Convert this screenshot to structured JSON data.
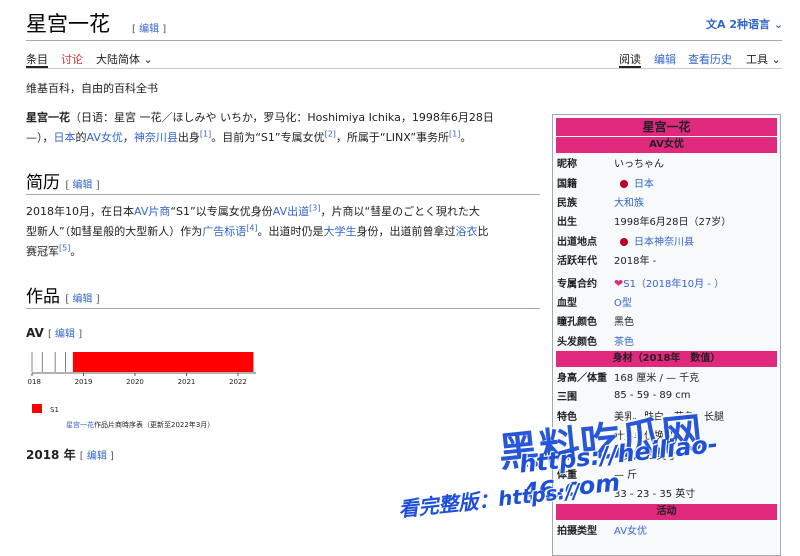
{
  "header": {
    "title": "星宫一花",
    "edit_label": "编辑",
    "languages_label": "2种语言"
  },
  "tabs": {
    "article": "条目",
    "talk": "讨论",
    "variant": "大陆简体",
    "read": "阅读",
    "edit": "编辑",
    "history": "查看历史",
    "tools": "工具"
  },
  "tagline": "维基百科，自由的百科全书",
  "intro": {
    "name": "星宫一花",
    "p1": "（日语：星宮 一花／ほしみや いちか，罗马化：Hoshimiya Ichika，1998年6月28日",
    "p2a": "—），",
    "japan": "日本",
    "p2b": "的",
    "av_actress": "AV女优",
    "p2c": "，",
    "kanagawa": "神奈川县",
    "p2d": "出身",
    "ref1": "[1]",
    "p2e": "。目前为“S1”专属女优",
    "ref2": "[2]",
    "p2f": "，所属于“LINX”事务所",
    "ref3": "[1]",
    "p2g": "。"
  },
  "sections": {
    "biography": {
      "title": "简历",
      "edit": "编辑",
      "t1": "2018年10月，在日本",
      "l1": "AV片商",
      "t2": "“S1”以专属女优身份",
      "l2": "AV出道",
      "r1": "[3]",
      "t3": "，片商以“彗星のごとく現れた大",
      "t4": "型新人”（如彗星般的大型新人）作为",
      "l3": "广告标语",
      "r2": "[4]",
      "t5": "。出道时仍是",
      "l4": "大学生",
      "t6": "身份，出道前曾拿过",
      "l5": "浴衣",
      "t7": "比",
      "t8": "赛冠军",
      "r3": "[5]",
      "t9": "。"
    },
    "works": {
      "title": "作品",
      "edit": "编辑"
    },
    "av": {
      "title": "AV",
      "edit": "编辑"
    },
    "y2018": {
      "title": "2018 年",
      "edit": "编辑"
    }
  },
  "timeline": {
    "years": [
      "2018",
      "2019",
      "2020",
      "2021",
      "2022"
    ],
    "legend_label": "S1",
    "caption_link": "星宫一花",
    "caption_text": "作品片商時序表（更新至2022年3月）",
    "bar_color": "#ff0000",
    "bar_start_year": 2018.8,
    "bar_end_year": 2022.3,
    "tick_years": [
      2018.0,
      2018.2,
      2018.45,
      2018.65,
      2018.8
    ]
  },
  "infobox": {
    "title": "星宫一花",
    "subtitle": "AV女优",
    "rows1": [
      {
        "key": "昵称",
        "value": "いっちゃん",
        "link": false,
        "flag": false
      },
      {
        "key": "国籍",
        "value": "日本",
        "link": true,
        "flag": true
      },
      {
        "key": "民族",
        "value": "大和族",
        "link": true,
        "flag": false
      },
      {
        "key": "出生",
        "value": "1998年6月28日（27岁）",
        "link": false,
        "flag": false
      },
      {
        "key": "出道地点",
        "value": "日本神奈川县",
        "link": true,
        "flag": true
      },
      {
        "key": "活跃年代",
        "value": "2018年 -",
        "link": false,
        "flag": false
      }
    ],
    "rows2": [
      {
        "key": "专属合约",
        "value": "S1（2018年10月 - ）",
        "heart": true
      },
      {
        "key": "血型",
        "value": "O型",
        "link": true
      },
      {
        "key": "瞳孔颜色",
        "value": "黑色",
        "link": false
      },
      {
        "key": "头发颜色",
        "value": "茶色",
        "link": true
      }
    ],
    "body_header": "身材（2018年　数值）",
    "rows3": [
      {
        "key": "身高／体重",
        "value": "168 厘米 / — 千克"
      },
      {
        "key": "三围",
        "value": "85 - 59 - 89 cm"
      },
      {
        "key": "特色",
        "value": "美乳、肤白、苗条、长腿"
      },
      {
        "key": "",
        "value": "计量单位换算"
      },
      {
        "key": "身高",
        "value": "5 英尺 6 英寸"
      },
      {
        "key": "体重",
        "value": "— 斤"
      },
      {
        "key": "",
        "value": "33 - 23 - 35 英寸"
      }
    ],
    "activity_header": "活动",
    "rows4": [
      {
        "key": "拍摄类型",
        "value": "AV女优",
        "link": true
      }
    ],
    "accent_color": "#e0297c"
  },
  "watermark": {
    "line1": "黑料吃瓜网",
    "line2": "https://heiliao-46.com",
    "line3": "看完整版：https://"
  }
}
